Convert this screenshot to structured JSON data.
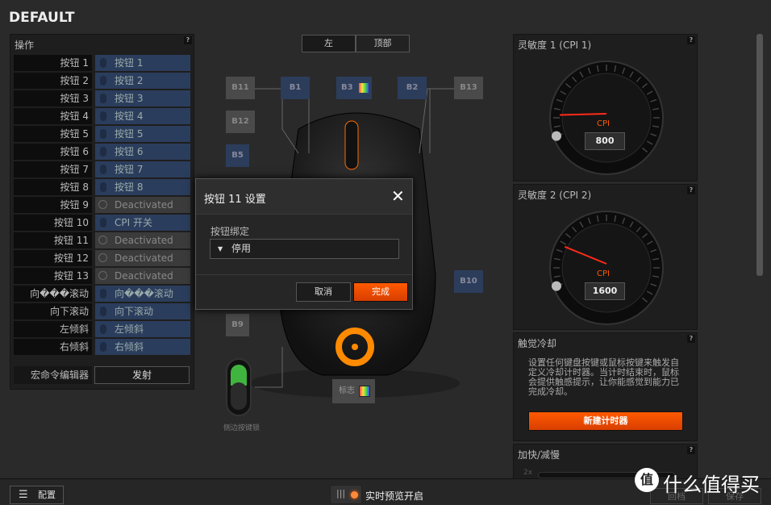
{
  "title": "DEFAULT",
  "actions": {
    "title": "操作",
    "help": "?",
    "rows": [
      {
        "button": "按钮 1",
        "binding": "按钮 1",
        "deactivated": false
      },
      {
        "button": "按钮 2",
        "binding": "按钮 2",
        "deactivated": false
      },
      {
        "button": "按钮 3",
        "binding": "按钮 3",
        "deactivated": false
      },
      {
        "button": "按钮 4",
        "binding": "按钮 4",
        "deactivated": false
      },
      {
        "button": "按钮 5",
        "binding": "按钮 5",
        "deactivated": false
      },
      {
        "button": "按钮 6",
        "binding": "按钮 6",
        "deactivated": false
      },
      {
        "button": "按钮 7",
        "binding": "按钮 7",
        "deactivated": false
      },
      {
        "button": "按钮 8",
        "binding": "按钮 8",
        "deactivated": false
      },
      {
        "button": "按钮 9",
        "binding": "Deactivated",
        "deactivated": true
      },
      {
        "button": "按钮 10",
        "binding": "CPI 开关",
        "deactivated": false
      },
      {
        "button": "按钮 11",
        "binding": "Deactivated",
        "deactivated": true
      },
      {
        "button": "按钮 12",
        "binding": "Deactivated",
        "deactivated": true
      },
      {
        "button": "按钮 13",
        "binding": "Deactivated",
        "deactivated": true
      },
      {
        "button": "向���滚动",
        "binding": "向���滚动",
        "deactivated": false
      },
      {
        "button": "向下滚动",
        "binding": "向下滚动",
        "deactivated": false
      },
      {
        "button": "左倾斜",
        "binding": "左倾斜",
        "deactivated": false
      },
      {
        "button": "右倾斜",
        "binding": "右倾斜",
        "deactivated": false
      }
    ],
    "macro_label": "宏命令编辑器",
    "fire_button": "发射"
  },
  "view_tabs": [
    "左",
    "顶部"
  ],
  "mouse_buttons": {
    "b11": "B11",
    "b1": "B1",
    "b3": "B3",
    "b2": "B2",
    "b13": "B13",
    "b12": "B12",
    "b5": "B5",
    "b10": "B10",
    "b9": "B9",
    "logo": "标志",
    "side_lock": "侧边按键锁"
  },
  "dialog": {
    "title": "按钮 11 设置",
    "binding_label": "按钮绑定",
    "binding_value": "停用",
    "cancel": "取消",
    "done": "完成"
  },
  "cpi1": {
    "title": "灵敏度 1 (CPI 1)",
    "unit": "CPI",
    "value": "800"
  },
  "cpi2": {
    "title": "灵敏度 2 (CPI 2)",
    "unit": "CPI",
    "value": "1600"
  },
  "cooldown": {
    "title": "触觉冷却",
    "text": "设置任何键盘按键或鼠标按键来触发自定义冷却计时器。当计时结束时，鼠标会提供触感提示，让你能感觉到能力已完成冷却。",
    "button": "新建计时器"
  },
  "speed": {
    "title": "加快/减慢",
    "tick": "2x"
  },
  "bottom": {
    "config": "配置",
    "live_preview": "实时预览开启",
    "revert": "回档",
    "save": "保存"
  },
  "watermark": "什么值得买",
  "colors": {
    "accent": "#ff5a00",
    "blue": "#2b3d5c",
    "green": "#3fb53f"
  }
}
